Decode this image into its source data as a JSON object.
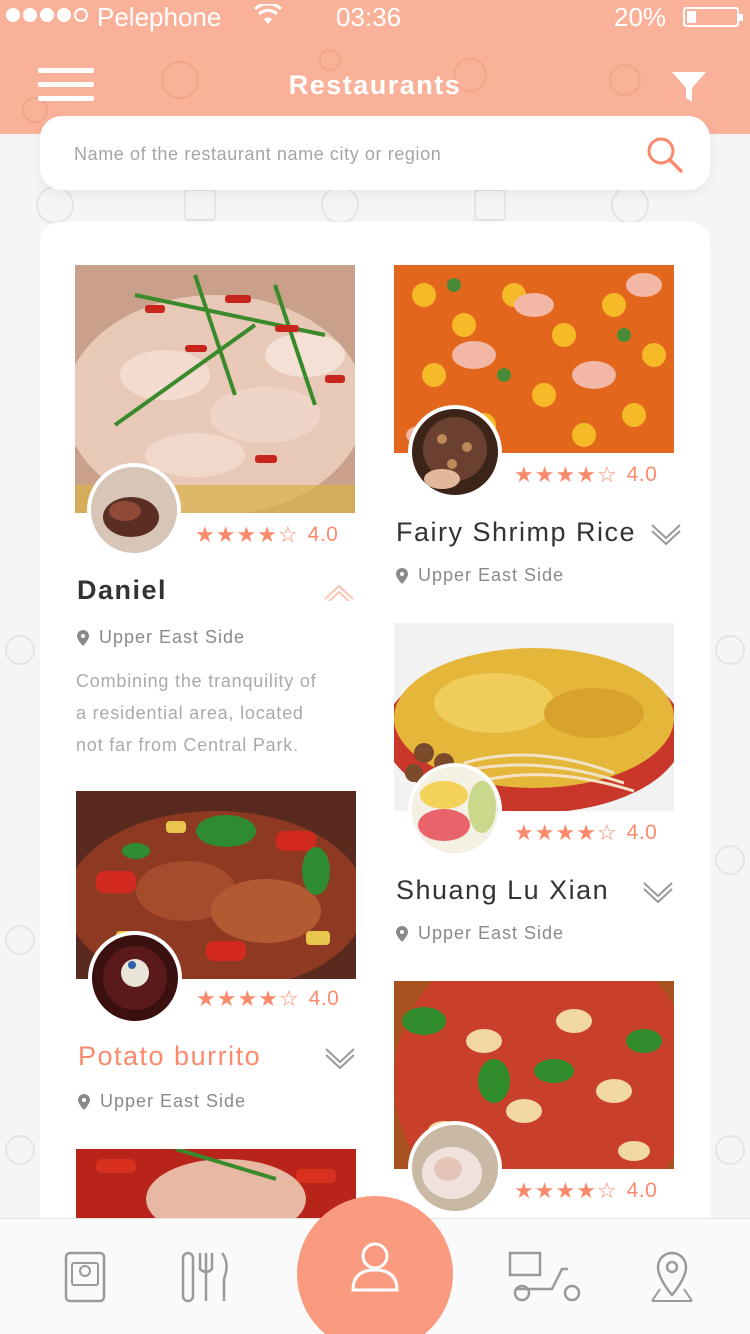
{
  "status_bar": {
    "carrier": "Pelephone",
    "time": "03:36",
    "battery": "20%"
  },
  "header": {
    "title": "Restaurants",
    "menu_icon": "hamburger-menu-icon",
    "filter_icon": "filter-icon"
  },
  "search": {
    "placeholder": "Name of the restaurant name city or region",
    "icon": "search-icon"
  },
  "restaurants": [
    {
      "name": "Daniel",
      "rating": 4,
      "rating_text": "4.0",
      "location": "Upper East Side",
      "description_lines": [
        "Combining the tranquility of",
        "a residential area, located",
        "not far from Central Park."
      ],
      "expanded": true
    },
    {
      "name": "Fairy Shrimp Rice",
      "rating": 4,
      "rating_text": "4.0",
      "location": "Upper East Side",
      "expanded": false
    },
    {
      "name": "Potato burrito",
      "rating": 4,
      "rating_text": "4.0",
      "location": "Upper East Side",
      "expanded": false
    },
    {
      "name": "Shuang Lu Xian",
      "rating": 4,
      "rating_text": "4.0",
      "location": "Upper East Side",
      "expanded": false
    },
    {
      "rating": 4,
      "rating_text": "4.0"
    }
  ],
  "tabbar": {
    "items": [
      "menu-book-icon",
      "fork-knife-icon",
      "user-icon",
      "delivery-scooter-icon",
      "map-pin-icon"
    ]
  },
  "colors": {
    "header": "#f9b199",
    "accent": "#fa8a6c",
    "fab": "#fa9b7f"
  }
}
